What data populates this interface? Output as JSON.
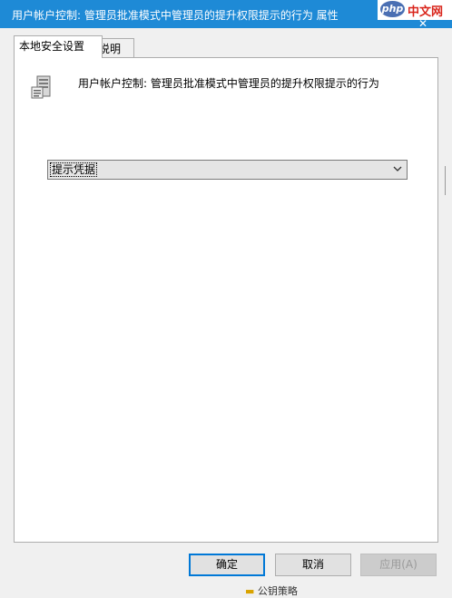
{
  "window": {
    "title": "用户帐户控制: 管理员批准模式中管理员的提升权限提示的行为 属性"
  },
  "watermark": {
    "logo": "php",
    "text": "中文网"
  },
  "tabs": [
    {
      "label": "本地安全设置",
      "active": true
    },
    {
      "label": "说明",
      "active": false
    }
  ],
  "policy": {
    "icon": "server-policy-icon",
    "title": "用户帐户控制: 管理员批准模式中管理员的提升权限提示的行为"
  },
  "setting": {
    "selected": "提示凭据"
  },
  "buttons": {
    "ok": "确定",
    "cancel": "取消",
    "apply": "应用(A)"
  },
  "background": {
    "partial_text": "公钥策略"
  },
  "colors": {
    "titlebar": "#1e8ad6",
    "accent": "#0078d7"
  }
}
